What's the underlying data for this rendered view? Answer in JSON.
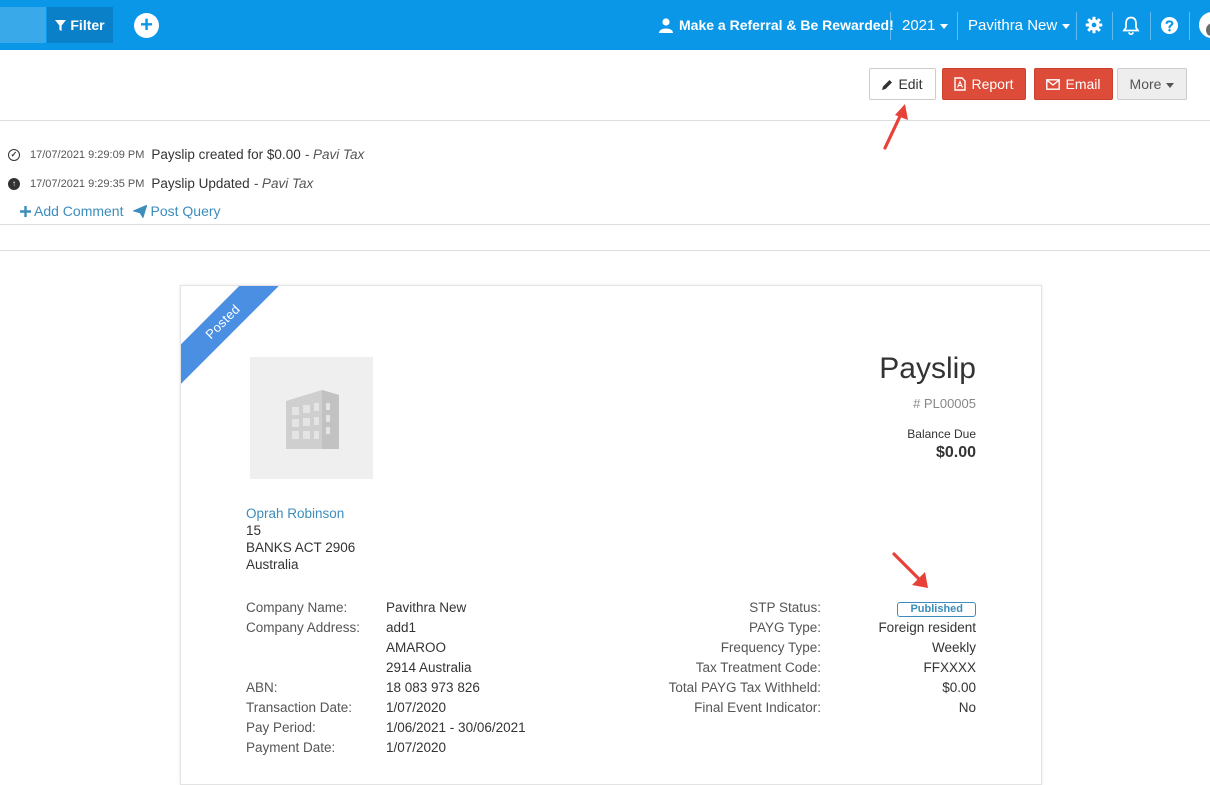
{
  "topbar": {
    "filter_label": "Filter",
    "referral_text": "Make a Referral & Be Rewarded!",
    "year": "2021",
    "user_name": "Pavithra New"
  },
  "toolbar": {
    "edit_label": "Edit",
    "report_label": "Report",
    "email_label": "Email",
    "more_label": "More"
  },
  "activity": [
    {
      "timestamp": "17/07/2021 9:29:09 PM",
      "message": "Payslip created for $0.00",
      "author": "- Pavi Tax"
    },
    {
      "timestamp": "17/07/2021 9:29:35 PM",
      "message": "Payslip Updated",
      "author": "- Pavi Tax"
    }
  ],
  "actions": {
    "add_comment": "Add Comment",
    "post_query": "Post Query"
  },
  "payslip": {
    "ribbon": "Posted",
    "title": "Payslip",
    "number": "# PL00005",
    "balance_label": "Balance Due",
    "balance_value": "$0.00",
    "employee": {
      "name": "Oprah Robinson",
      "line1": "15",
      "line2": "BANKS ACT 2906",
      "line3": "Australia"
    },
    "fields": [
      {
        "label": "Company Name:",
        "value": "Pavithra New"
      },
      {
        "label": "Company Address:",
        "value": "add1"
      },
      {
        "label": "",
        "value": "AMAROO"
      },
      {
        "label": "",
        "value": "2914 Australia"
      },
      {
        "label": "ABN:",
        "value": "18 083 973 826"
      },
      {
        "label": "Transaction Date:",
        "value": "1/07/2020"
      },
      {
        "label": "Pay Period:",
        "value": "1/06/2021 - 30/06/2021"
      },
      {
        "label": "Payment Date:",
        "value": "1/07/2020"
      }
    ],
    "stp": [
      {
        "label": "STP Status:",
        "value": "Published"
      },
      {
        "label": "PAYG Type:",
        "value": "Foreign resident"
      },
      {
        "label": "Frequency Type:",
        "value": "Weekly"
      },
      {
        "label": "Tax Treatment Code:",
        "value": "FFXXXX"
      },
      {
        "label": "Total PAYG Tax Withheld:",
        "value": "$0.00"
      },
      {
        "label": "Final Event Indicator:",
        "value": "No"
      }
    ]
  },
  "colors": {
    "topbar": "#0b97e8",
    "danger": "#dd4b39",
    "link": "#3c8dbc",
    "ribbon": "#4a8fe2",
    "annotation_arrow": "#e8413a"
  }
}
